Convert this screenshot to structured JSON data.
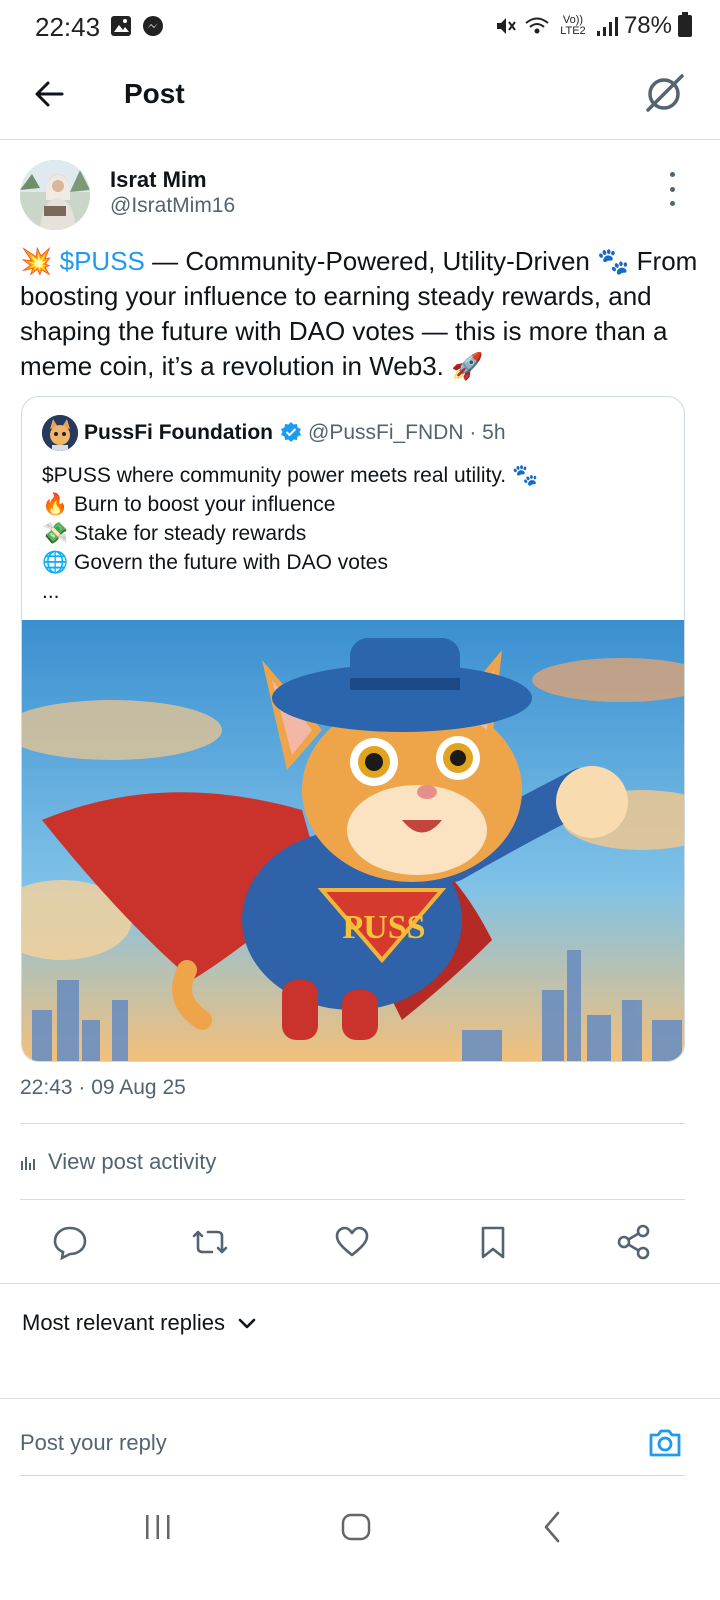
{
  "status_bar": {
    "time": "22:43",
    "battery": "78%",
    "network": "Vo)) LTE2"
  },
  "header": {
    "title": "Post"
  },
  "author": {
    "name": "Israt Mim",
    "handle": "@IsratMim16"
  },
  "post": {
    "emoji_start": "💥",
    "cashtag": "$PUSS",
    "text": " — Community-Powered, Utility-Driven 🐾 From boosting your influence to earning steady rewards, and shaping the future with DAO votes — this is more than a meme coin, it’s a revolution in Web3. 🚀"
  },
  "quoted_post": {
    "name": "PussFi Foundation",
    "handle": "@PussFi_FNDN",
    "time": "· 5h",
    "lines": [
      "$PUSS where community power meets real utility. 🐾",
      "🔥 Burn to boost your influence",
      "💸 Stake for steady rewards",
      "🌐 Govern the future with DAO votes",
      "..."
    ],
    "image_text": "PUSS"
  },
  "meta": {
    "timestamp": "22:43 · 09 Aug 25",
    "view_activity": "View post activity"
  },
  "replies": {
    "sort_label": "Most relevant replies",
    "reply_placeholder": "Post your reply"
  },
  "icons": {
    "back": "back-arrow-icon",
    "grok": "grok-icon",
    "more": "more-vertical-icon",
    "reply": "reply-icon",
    "repost": "repost-icon",
    "like": "heart-icon",
    "bookmark": "bookmark-icon",
    "share": "share-icon",
    "camera": "camera-icon"
  },
  "colors": {
    "accent": "#1d9bf0",
    "text": "#0f1419",
    "secondary": "#536471",
    "divider": "#d6dbdf"
  }
}
